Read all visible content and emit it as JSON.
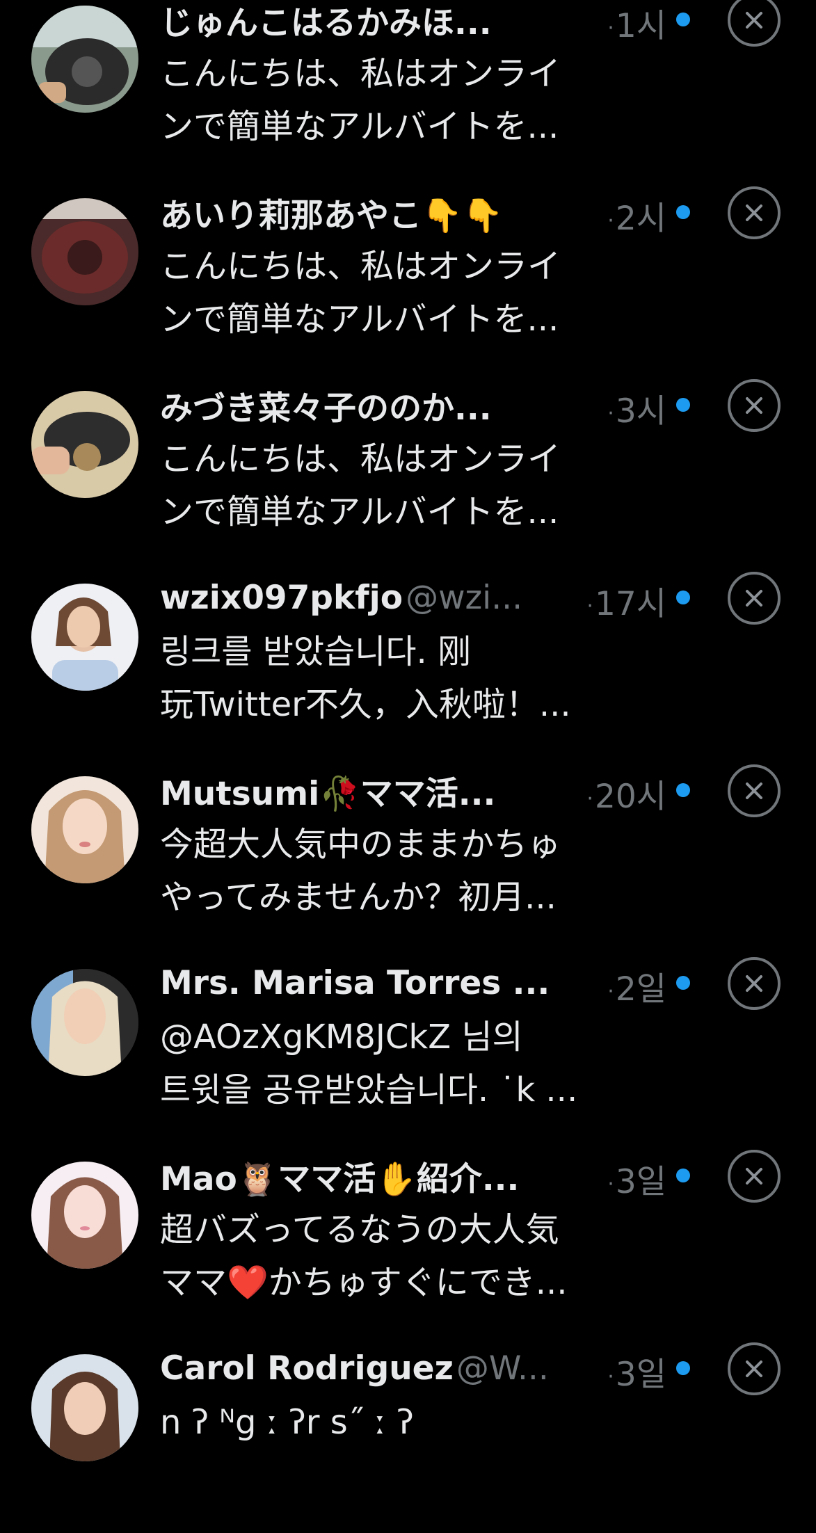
{
  "colors": {
    "background": "#000000",
    "text": "#e7e9ea",
    "muted": "#71767b",
    "unread_dot": "#1d9bf0"
  },
  "icons": {
    "close": "close-circle-icon",
    "unread": "unread-dot-icon"
  },
  "messages": [
    {
      "name": "じゅんこはるかみほ...",
      "handle": "",
      "time": "1시",
      "line1": "こんにちは、私はオンライ",
      "line2": "ンで簡単なアルバイトを..."
    },
    {
      "name": "あいり莉那あやこ👇👇",
      "handle": "",
      "time": "2시",
      "line1": "こんにちは、私はオンライ",
      "line2": "ンで簡単なアルバイトを..."
    },
    {
      "name": "みづき菜々子ののか...",
      "handle": "",
      "time": "3시",
      "line1": "こんにちは、私はオンライ",
      "line2": "ンで簡単なアルバイトを..."
    },
    {
      "name": "wzix097pkfjo",
      "handle": "@wzi...",
      "time": "17시",
      "line1": "링크를 받았습니다. 刚",
      "line2": "玩Twitter不久，入秋啦！..."
    },
    {
      "name": "Mutsumi🥀ママ活...",
      "handle": "",
      "time": "20시",
      "line1": "今超大人気中のままかちゅ",
      "line2": "やってみませんか？初月..."
    },
    {
      "name": "Mrs. Marisa Torres ...",
      "handle": "",
      "time": "2일",
      "line1": "@AOzXgKM8JCkZ 님의",
      "line2": "트윗을 공유받았습니다. ˙k ..."
    },
    {
      "name": "Mao🦉ママ活✋紹介...",
      "handle": "",
      "time": "3일",
      "line1": "超バズってるなうの大人気",
      "line2": "ママ❤️かちゅすぐにでき..."
    },
    {
      "name": "Carol Rodriguez",
      "handle": "@W...",
      "time": "3일",
      "line1": "n ʔ   ᴺg  ː ʔr  s˝ ː ʔ",
      "line2": ""
    }
  ]
}
